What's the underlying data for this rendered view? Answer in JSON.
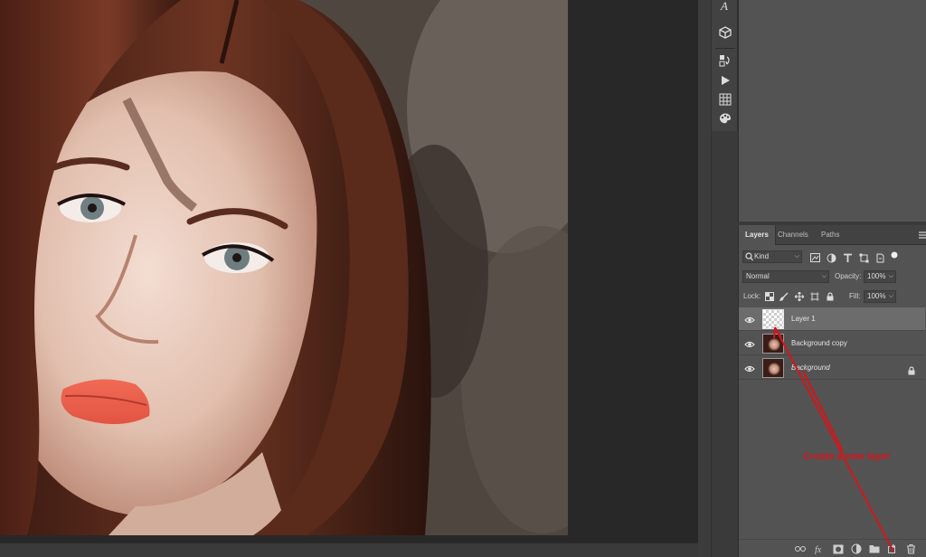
{
  "layers_panel": {
    "tabs": [
      {
        "label": "Layers",
        "active": true
      },
      {
        "label": "Channels",
        "active": false
      },
      {
        "label": "Paths",
        "active": false
      }
    ],
    "filter": {
      "label": "Kind"
    },
    "blend_mode": "Normal",
    "opacity_label": "Opacity:",
    "opacity_value": "100%",
    "lock_label": "Lock:",
    "fill_label": "Fill:",
    "fill_value": "100%",
    "layers": [
      {
        "name": "Layer 1",
        "selected": true,
        "thumbnail": "transparent",
        "locked": false
      },
      {
        "name": "Background copy",
        "selected": false,
        "thumbnail": "portrait",
        "locked": false
      },
      {
        "name": "Background",
        "selected": false,
        "thumbnail": "portrait",
        "locked": true
      }
    ]
  },
  "tool_strip": {
    "icons": [
      "character-icon",
      "3d-cube-icon",
      "history-icon",
      "play-actions-icon",
      "grid-icon",
      "palette-icon"
    ]
  },
  "annotation": {
    "text": "Create a new layer",
    "color": "#d4161b"
  },
  "colors": {
    "panel_bg": "#535353",
    "selected_row": "#6c6c6c",
    "workspace_bg": "#282828"
  }
}
